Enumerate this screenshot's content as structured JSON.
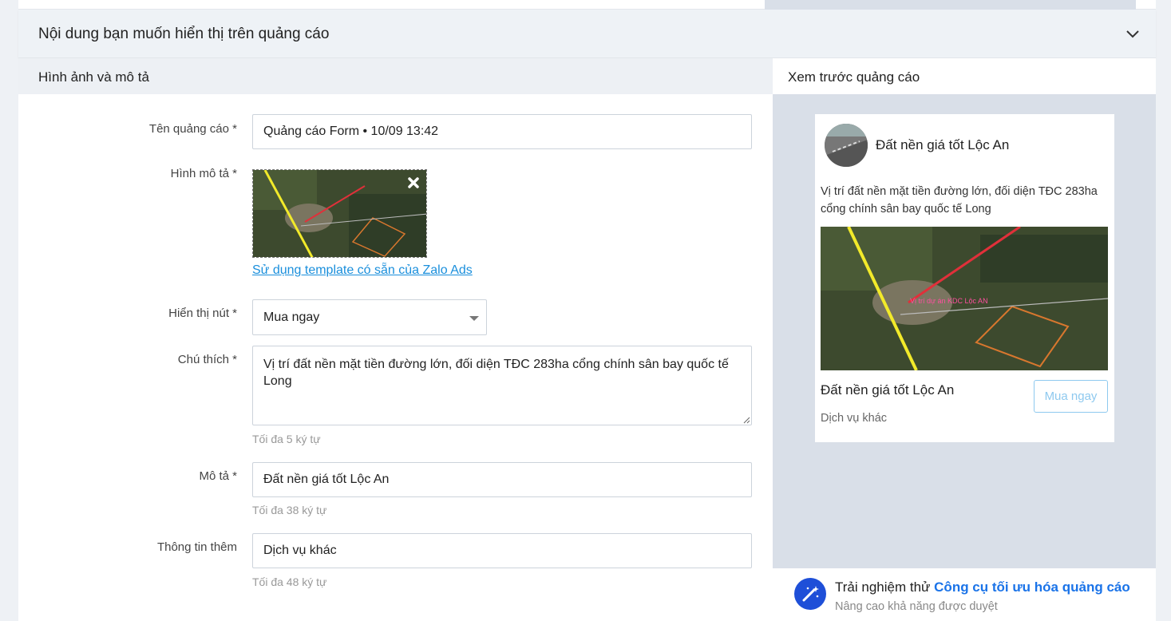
{
  "section": {
    "title": "Nội dung bạn muốn hiển thị trên quảng cáo"
  },
  "left": {
    "heading": "Hình ảnh và mô tả",
    "ad_name": {
      "label": "Tên quảng cáo *",
      "value": "Quảng cáo Form • 10/09 13:42"
    },
    "image": {
      "label": "Hình mô tả *",
      "template_link": "Sử dụng template có sẵn của Zalo Ads"
    },
    "button": {
      "label": "Hiển thị nút *",
      "value": "Mua ngay"
    },
    "caption": {
      "label": "Chú thích *",
      "value": "Vị trí đất nền mặt tiền đường lớn, đối diện TĐC 283ha cổng chính sân bay quốc tế Long",
      "hint": "Tối đa 5 ký tự"
    },
    "description": {
      "label": "Mô tả *",
      "value": "Đất nền giá tốt Lộc An",
      "hint": "Tối đa 38 ký tự"
    },
    "extra": {
      "label": "Thông tin thêm",
      "value": "Dịch vụ khác",
      "hint": "Tối đa 48 ký tự"
    }
  },
  "preview": {
    "heading": "Xem trước quảng cáo",
    "page_name": "Đất nền giá tốt Lộc An",
    "text": "Vị trí đất nền mặt tiền đường lớn, đối diện TĐC 283ha cổng chính sân bay quốc tế Long",
    "title": "Đất nền giá tốt Lộc An",
    "subtitle": "Dịch vụ khác",
    "button": "Mua ngay",
    "image_label": "Vị trí dự án KDC Lộc AN"
  },
  "promo": {
    "prefix": "Trải nghiệm thử",
    "link": "Công cụ tối ưu hóa quảng cáo",
    "sub": "Nâng cao khả năng được duyệt",
    "icon": "magic-wand-icon"
  },
  "colors": {
    "accent": "#1a73e8",
    "link": "#1a8fdc",
    "preview_bg": "#d9dfe8",
    "promo_icon_bg": "#1e4fd8"
  }
}
